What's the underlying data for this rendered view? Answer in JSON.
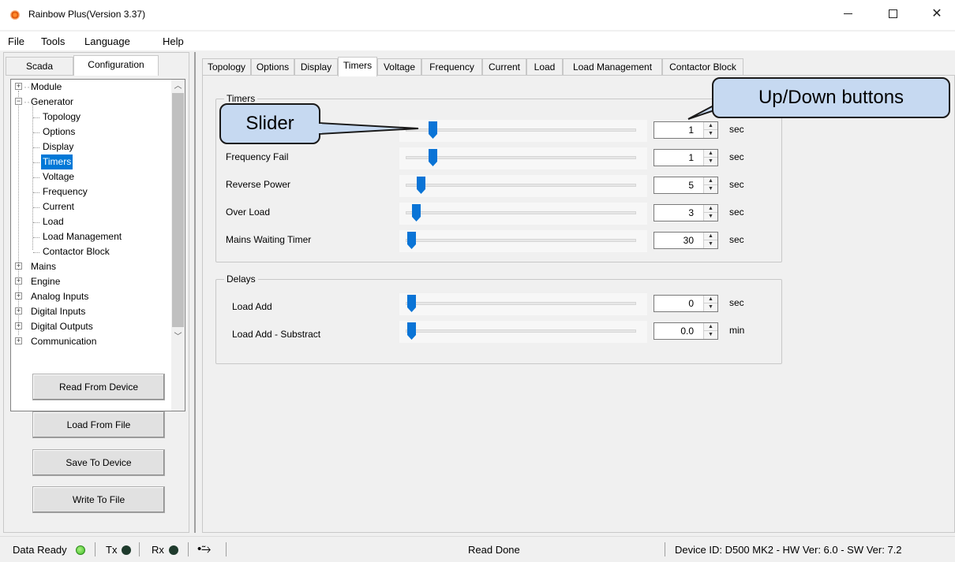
{
  "window": {
    "title": "Rainbow Plus(Version 3.37)"
  },
  "menu": [
    "File",
    "Tools",
    "Language",
    "Help"
  ],
  "left_tabs": [
    "Scada",
    "Configuration"
  ],
  "tree": {
    "module": "Module",
    "generator": "Generator",
    "generator_children": [
      "Topology",
      "Options",
      "Display",
      "Timers",
      "Voltage",
      "Frequency",
      "Current",
      "Load",
      "Load Management",
      "Contactor Block"
    ],
    "selected_child": "Timers",
    "others": [
      "Mains",
      "Engine",
      "Analog Inputs",
      "Digital Inputs",
      "Digital Outputs",
      "Communication"
    ]
  },
  "buttons": {
    "read_device": "Read From Device",
    "load_file": "Load From File",
    "save_device": "Save To Device",
    "write_file": "Write To File"
  },
  "right_tabs": [
    "Topology",
    "Options",
    "Display",
    "Timers",
    "Voltage",
    "Frequency",
    "Current",
    "Load",
    "Load Management",
    "Contactor Block"
  ],
  "active_right_tab": "Timers",
  "timers": {
    "title": "Timers",
    "rows": [
      {
        "label": "",
        "value": "1",
        "unit": "sec"
      },
      {
        "label": "Frequency Fail",
        "value": "1",
        "unit": "sec"
      },
      {
        "label": "Reverse Power",
        "value": "5",
        "unit": "sec"
      },
      {
        "label": "Over Load",
        "value": "3",
        "unit": "sec"
      },
      {
        "label": "Mains Waiting Timer",
        "value": "30",
        "unit": "sec"
      }
    ]
  },
  "delays": {
    "title": "Delays",
    "rows": [
      {
        "label": "Load Add",
        "value": "0",
        "unit": "sec"
      },
      {
        "label": "Load Add - Substract",
        "value": "0.0",
        "unit": "min"
      }
    ]
  },
  "callouts": {
    "slider": "Slider",
    "updown": "Up/Down buttons"
  },
  "status": {
    "data_ready": "Data Ready",
    "tx": "Tx",
    "rx": "Rx",
    "message": "Read Done",
    "device": "Device ID: D500 MK2 - HW Ver: 6.0 - SW Ver: 7.2"
  },
  "colors": {
    "selection": "#0078d7",
    "slider_thumb": "#0a74d6",
    "led_green": "#3fbf2a",
    "led_dark": "#1e3a2c",
    "callout_fill": "#c6d9f1"
  },
  "icons": [
    "app-icon",
    "minimize-icon",
    "maximize-icon",
    "close-icon",
    "expand-icon",
    "collapse-icon",
    "usb-icon"
  ]
}
